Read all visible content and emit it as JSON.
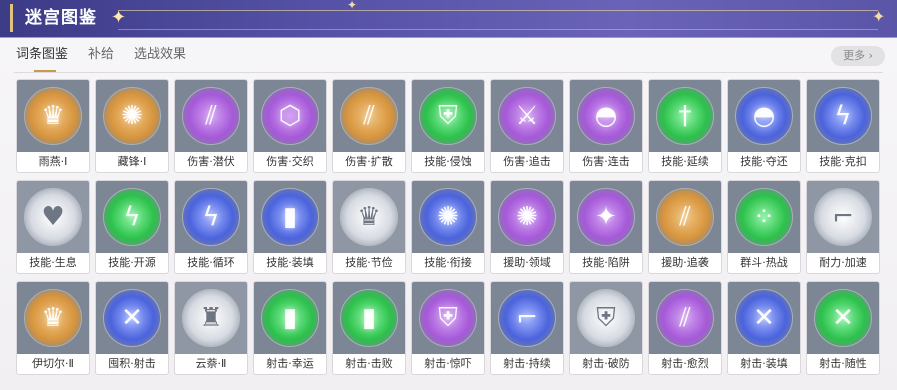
{
  "header": {
    "title": "迷宫图鉴"
  },
  "tabs": [
    {
      "label": "词条图鉴",
      "active": true
    },
    {
      "label": "补给",
      "active": false
    },
    {
      "label": "选战效果",
      "active": false
    }
  ],
  "more": {
    "label": "更多 ›"
  },
  "cards": [
    {
      "label": "雨燕·Ⅰ",
      "theme": "gold",
      "icon": "crown-sigil-icon"
    },
    {
      "label": "藏锋·Ⅰ",
      "theme": "gold",
      "icon": "swirl-icon"
    },
    {
      "label": "伤害·潜伏",
      "theme": "purple",
      "icon": "claw-slash-icon"
    },
    {
      "label": "伤害·交织",
      "theme": "purple",
      "icon": "cross-hex-icon"
    },
    {
      "label": "伤害·扩散",
      "theme": "gold",
      "icon": "claw-slash-icon"
    },
    {
      "label": "技能·侵蚀",
      "theme": "green",
      "icon": "armor-icon"
    },
    {
      "label": "伤害·追击",
      "theme": "purple",
      "icon": "split-arrows-icon"
    },
    {
      "label": "伤害·连击",
      "theme": "purple",
      "icon": "helmet-icon"
    },
    {
      "label": "技能·延续",
      "theme": "green",
      "icon": "blade-ring-icon"
    },
    {
      "label": "技能·夺还",
      "theme": "blue",
      "icon": "helmet-icon"
    },
    {
      "label": "技能·克扣",
      "theme": "blue",
      "icon": "lightning-icon"
    },
    {
      "label": "技能·生息",
      "theme": "white",
      "icon": "heart-plus-icon"
    },
    {
      "label": "技能·开源",
      "theme": "green",
      "icon": "lightning-icon"
    },
    {
      "label": "技能·循环",
      "theme": "blue",
      "icon": "lightning-icon"
    },
    {
      "label": "技能·装填",
      "theme": "blue",
      "icon": "ammo-icon"
    },
    {
      "label": "技能·节俭",
      "theme": "white",
      "icon": "crown-sigil-icon"
    },
    {
      "label": "技能·衔接",
      "theme": "blue",
      "icon": "swirl-icon"
    },
    {
      "label": "援助·领域",
      "theme": "purple",
      "icon": "swirl-icon"
    },
    {
      "label": "技能·陷阱",
      "theme": "purple",
      "icon": "spark-icon"
    },
    {
      "label": "援助·追袭",
      "theme": "gold",
      "icon": "claw-slash-icon"
    },
    {
      "label": "群斗·热战",
      "theme": "green",
      "icon": "ring-dots-icon"
    },
    {
      "label": "耐力·加速",
      "theme": "white",
      "icon": "boot-icon"
    },
    {
      "label": "伊切尔·Ⅱ",
      "theme": "gold",
      "icon": "crown-sigil-icon"
    },
    {
      "label": "囤积·射击",
      "theme": "blue",
      "icon": "crossed-guns-icon"
    },
    {
      "label": "云萘·Ⅱ",
      "theme": "white",
      "icon": "signal-tower-icon"
    },
    {
      "label": "射击·幸运",
      "theme": "green",
      "icon": "ammo-icon"
    },
    {
      "label": "射击·击败",
      "theme": "green",
      "icon": "ammo-icon"
    },
    {
      "label": "射击·惊吓",
      "theme": "purple",
      "icon": "armor-icon"
    },
    {
      "label": "射击·持续",
      "theme": "blue",
      "icon": "boot-icon"
    },
    {
      "label": "射击·破防",
      "theme": "white",
      "icon": "armor-icon"
    },
    {
      "label": "射击·愈烈",
      "theme": "purple",
      "icon": "claw-slash-icon"
    },
    {
      "label": "射击·装填",
      "theme": "blue",
      "icon": "crossed-guns-icon"
    },
    {
      "label": "射击·随性",
      "theme": "green",
      "icon": "crossed-guns-icon"
    }
  ],
  "icon_glyphs": {
    "crown-sigil-icon": "♛",
    "swirl-icon": "✺",
    "claw-slash-icon": "⫽",
    "cross-hex-icon": "⬡",
    "armor-icon": "⛨",
    "split-arrows-icon": "⚔",
    "helmet-icon": "◓",
    "blade-ring-icon": "†",
    "lightning-icon": "ϟ",
    "heart-plus-icon": "♥",
    "ammo-icon": "▮",
    "spark-icon": "✦",
    "ring-dots-icon": "⁘",
    "boot-icon": "⌐",
    "crossed-guns-icon": "✕",
    "signal-tower-icon": "♜"
  },
  "colors": {
    "banner": "#4b4796",
    "tab_underline": "#c89a4a",
    "gold": "#d8953d",
    "purple": "#a659d9",
    "green": "#2cc24b",
    "blue": "#4b63dd",
    "white": "#d7dbe2"
  }
}
